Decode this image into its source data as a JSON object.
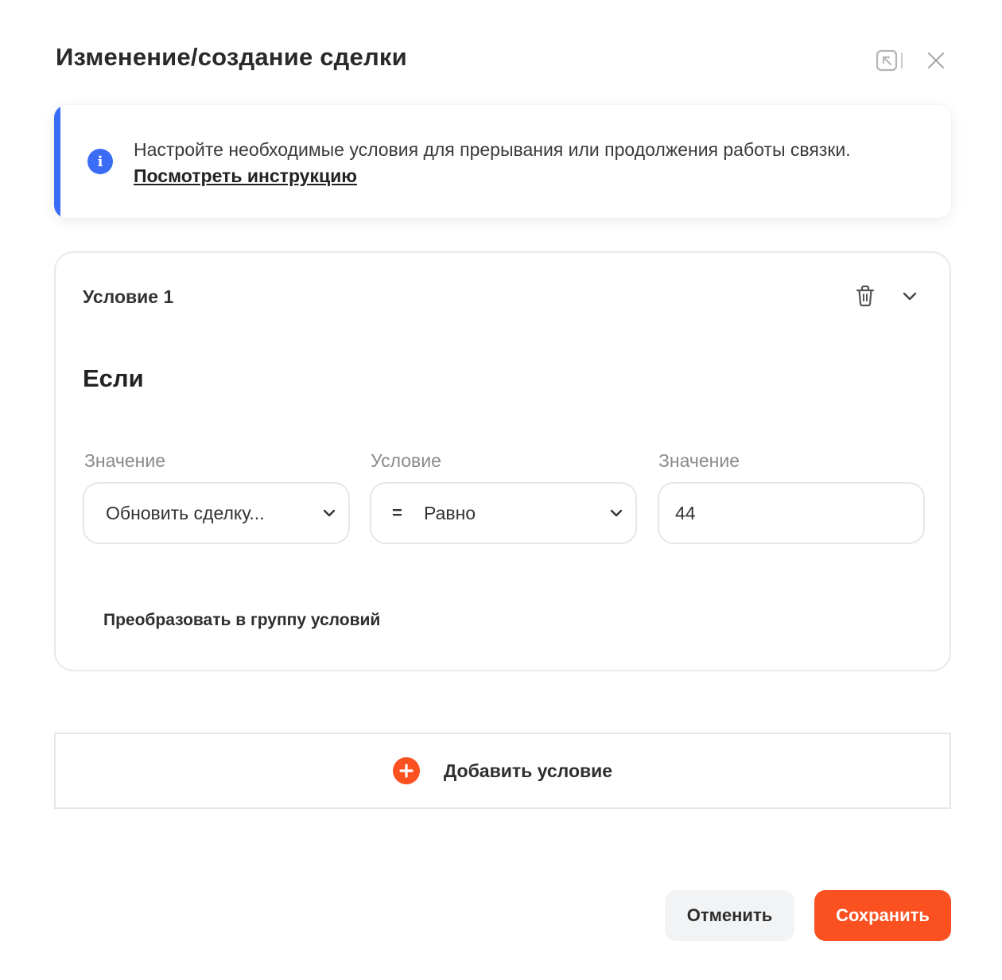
{
  "modal": {
    "title": "Изменение/создание сделки"
  },
  "info": {
    "text": "Настройте необходимые условия для прерывания или продолжения работы связки.",
    "link": "Посмотреть инструкцию",
    "icon": "info-icon"
  },
  "condition": {
    "title": "Условие 1",
    "if_label": "Если",
    "fields": [
      {
        "label": "Значение",
        "value": "Обновить сделку..."
      },
      {
        "label": "Условие",
        "symbol": "=",
        "value": "Равно"
      },
      {
        "label": "Значение",
        "value": "44"
      }
    ],
    "convert_link": "Преобразовать в группу условий"
  },
  "add_condition": {
    "label": "Добавить условие"
  },
  "footer": {
    "cancel": "Отменить",
    "save": "Сохранить"
  },
  "colors": {
    "accent": "#3b6cf6",
    "brand": "#fb5121"
  }
}
